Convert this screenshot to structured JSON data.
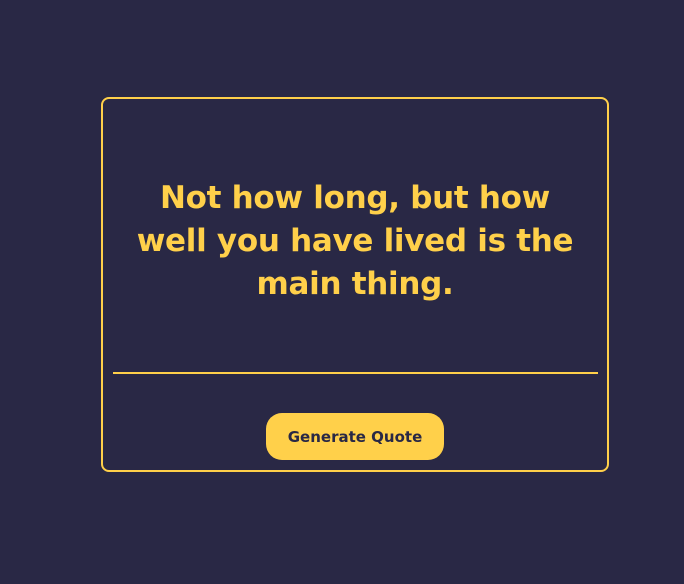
{
  "quote": {
    "text": "Not how long, but how well you have lived is the main thing."
  },
  "actions": {
    "generate_label": "Generate Quote"
  },
  "colors": {
    "background": "#292845",
    "accent": "#ffd04a"
  }
}
